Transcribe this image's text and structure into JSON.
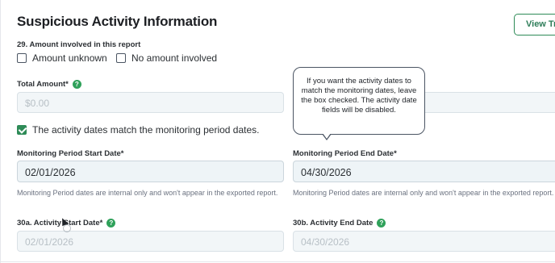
{
  "section": {
    "title": "Suspicious Activity Information",
    "view_button_label": "View Tra"
  },
  "amount_question": {
    "label": "29. Amount involved in this report",
    "options": [
      {
        "label": "Amount unknown",
        "checked": false
      },
      {
        "label": "No amount involved",
        "checked": false
      }
    ]
  },
  "total_amount": {
    "label": "Total Amount*",
    "help_icon": "question-circle-icon",
    "placeholder": "$0.00"
  },
  "match_dates": {
    "label": "The activity dates match the monitoring period dates.",
    "checked": true
  },
  "tooltip": {
    "text": "If you want the activity dates to match the monitoring dates, leave the box checked. The activity date fields will be disabled."
  },
  "monitoring_start": {
    "label": "Monitoring Period Start Date*",
    "value": "02/01/2026",
    "helper": "Monitoring Period dates are internal only and won't appear in the exported report."
  },
  "monitoring_end": {
    "label": "Monitoring Period End Date*",
    "value": "04/30/2026",
    "helper": "Monitoring Period dates are internal only and won't appear in the exported report."
  },
  "activity_start": {
    "label": "30a. Activity Start Date*",
    "help_icon": "question-circle-icon",
    "value": "02/01/2026"
  },
  "activity_end": {
    "label": "30b. Activity End Date",
    "help_icon": "question-circle-icon",
    "value": "04/30/2026"
  },
  "colors": {
    "accent_green": "#2e8b57",
    "help_green": "#2fa15a"
  }
}
